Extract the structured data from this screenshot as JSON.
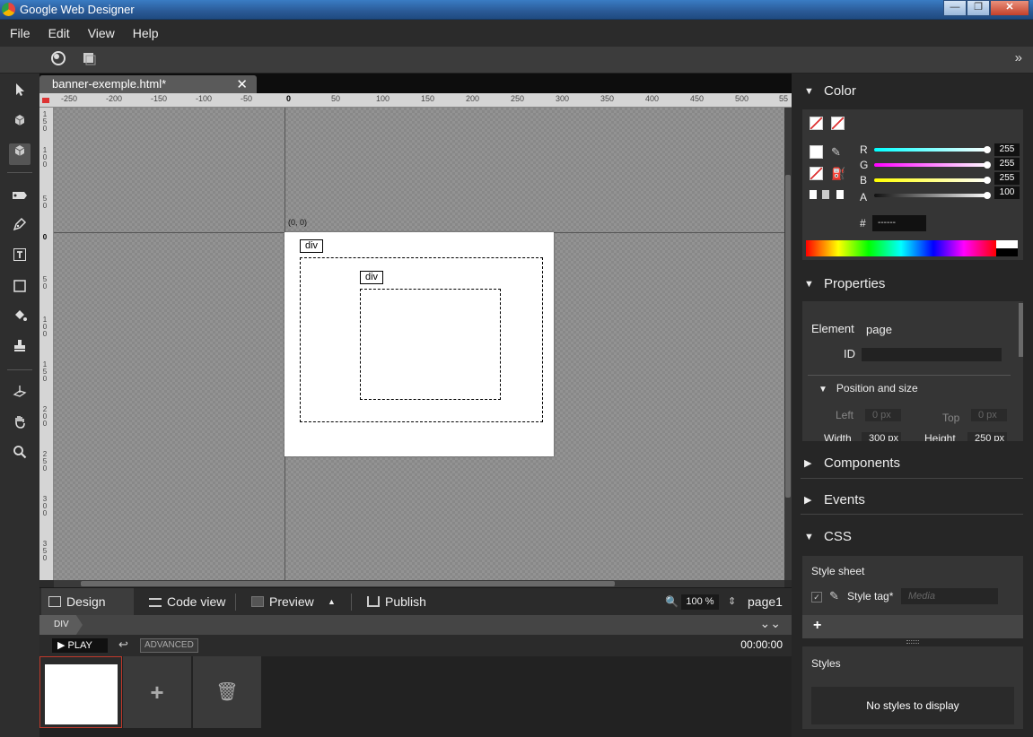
{
  "window": {
    "title": "Google Web Designer",
    "minimize": "—",
    "maximize": "❐",
    "close": "✕"
  },
  "menu": [
    "File",
    "Edit",
    "View",
    "Help"
  ],
  "toolbar": {
    "expand_icon": "double-chevron-right-icon",
    "expand_glyph": "»"
  },
  "tabs": [
    {
      "label": "banner-exemple.html*",
      "close": "✕"
    }
  ],
  "ruler": {
    "top_labels": [
      "-250",
      "-200",
      "-150",
      "-100",
      "-50",
      "0",
      "50",
      "100",
      "150",
      "200",
      "250",
      "300",
      "350",
      "400",
      "450",
      "500",
      "55"
    ],
    "left_labels": [
      "1 5 0",
      "1 0 0",
      "5 0",
      "0",
      "5 0",
      "1 0 0",
      "1 5 0",
      "2 0 0",
      "2 5 0",
      "3 0 0",
      "3 5 0",
      "4 0 0"
    ]
  },
  "stage": {
    "coord_label": "(0, 0)",
    "outer_div_tag": "div",
    "inner_div_tag": "div"
  },
  "viewbar": {
    "design_view": "Design view",
    "code_view": "Code view",
    "preview": "Preview",
    "preview_menu": "▲",
    "publish": "Publish",
    "zoom": "100 %",
    "zoom_stepper": "⇕",
    "page": "page1"
  },
  "breadcrumb": {
    "item": "DIV",
    "collapse": "⌄⌄"
  },
  "timeline": {
    "play": "▶ PLAY",
    "undo": "↩",
    "advanced": "ADVANCED",
    "time": "00:00:00"
  },
  "pages": {
    "add": "+",
    "delete": "🗑"
  },
  "panel": {
    "color": {
      "title": "Color",
      "channels": [
        {
          "label": "R",
          "value": "255",
          "gradient": "linear-gradient(90deg,#00ffff,#ffffff)"
        },
        {
          "label": "G",
          "value": "255",
          "gradient": "linear-gradient(90deg,#ff00ff,#ffffff)"
        },
        {
          "label": "B",
          "value": "255",
          "gradient": "linear-gradient(90deg,#ffff00,#ffffff)"
        },
        {
          "label": "A",
          "value": "100",
          "gradient": "linear-gradient(90deg,#111111,#ffffff)"
        }
      ],
      "hex_label": "#",
      "hex_value": "------"
    },
    "properties": {
      "title": "Properties",
      "element_label": "Element",
      "element_value": "page",
      "id_label": "ID",
      "position_title": "Position and size",
      "left_label": "Left",
      "left_value": "0 px",
      "top_label": "Top",
      "top_value": "0 px",
      "width_label": "Width",
      "width_value": "300 px",
      "height_label": "Height",
      "height_value": "250 px"
    },
    "components": {
      "title": "Components"
    },
    "events": {
      "title": "Events"
    },
    "css": {
      "title": "CSS",
      "style_sheet": "Style sheet",
      "style_tag": "Style tag*",
      "media_placeholder": "Media",
      "add": "+",
      "styles_title": "Styles",
      "no_styles": "No styles to display"
    }
  }
}
